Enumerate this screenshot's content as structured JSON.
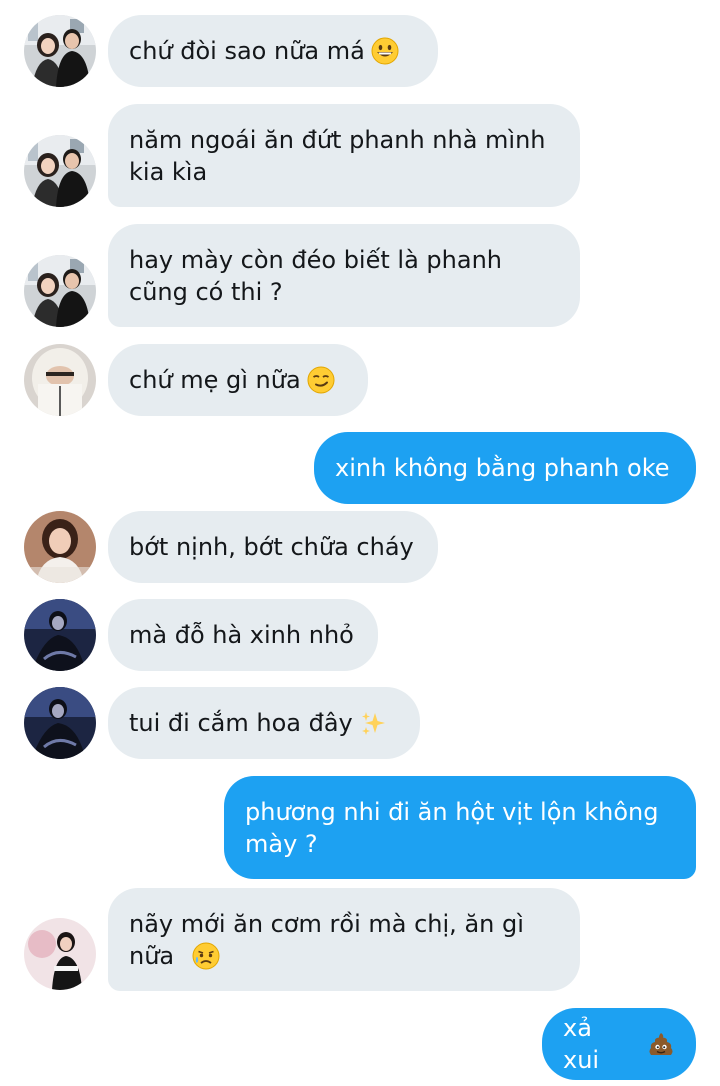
{
  "conversation": {
    "messages": [
      {
        "text": "chứ đòi sao nữa má",
        "emoji": "grinning-face"
      },
      {
        "text": "năm ngoái ăn đứt phanh nhà mình\nkia kìa"
      },
      {
        "text": "hay mày còn đéo biết là phanh\ncũng có thi ?"
      },
      {
        "text": "chứ mẹ gì nữa",
        "emoji": "smirking-face"
      },
      {
        "text": "xinh không bằng phanh oke"
      },
      {
        "text": "bớt nịnh, bớt chữa cháy"
      },
      {
        "text": "mà đỗ hà xinh nhỏ"
      },
      {
        "text": "tui đi cắm hoa đây",
        "emoji": "sparkles"
      },
      {
        "text": "phương nhi đi ăn hột vịt lộn không\nmày ?"
      },
      {
        "text": "nãy mới ăn cơm rồi mà chị, ăn gì\nnữa",
        "emoji": "sad-but-relieved-face"
      },
      {
        "text": "xả xui",
        "emoji": "pile-of-poo"
      }
    ]
  },
  "colors": {
    "incoming_bubble": "#e6ecf0",
    "outgoing_bubble": "#1da1f2",
    "incoming_text": "#14171a",
    "outgoing_text": "#ffffff"
  }
}
